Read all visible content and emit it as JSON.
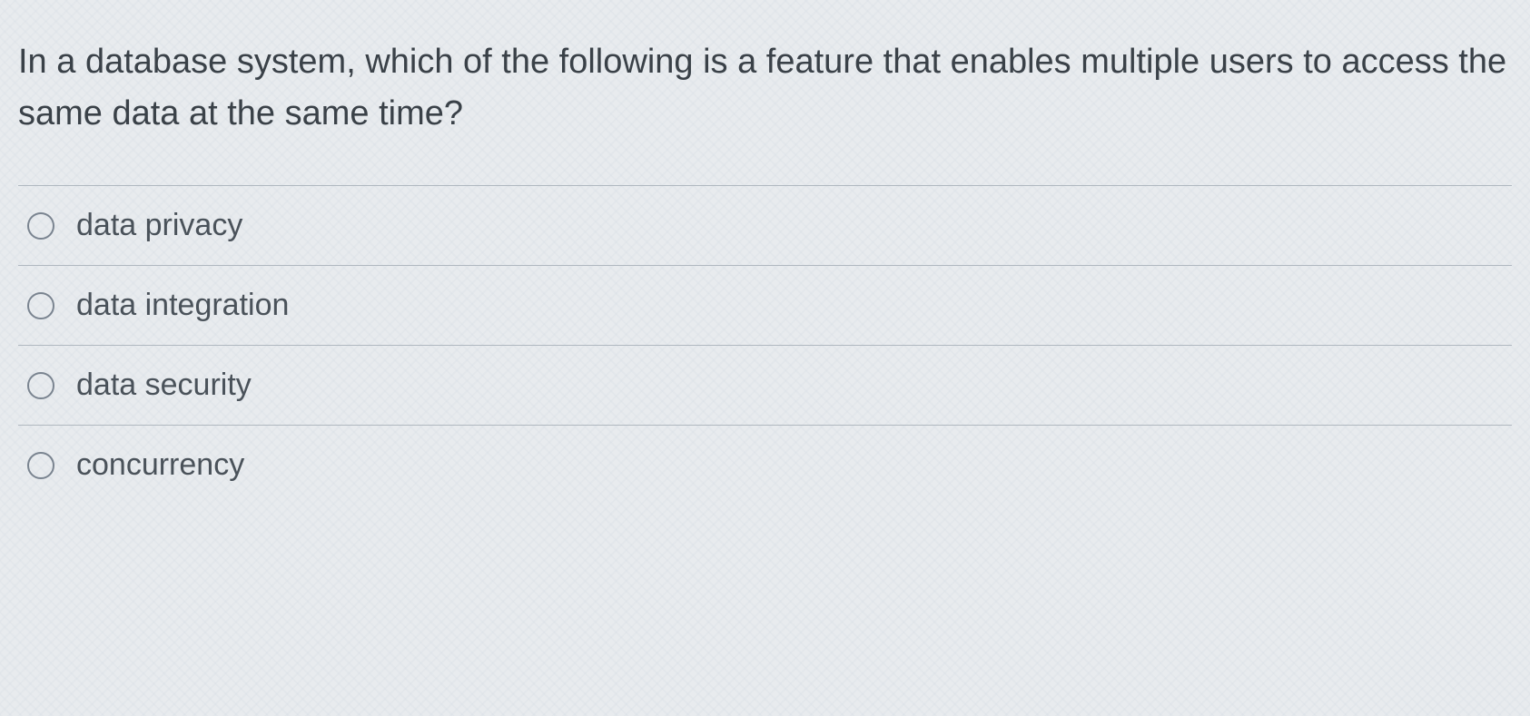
{
  "question": {
    "text": "In a database system, which of the following is a feature that enables multiple users to access the same data at the same time?"
  },
  "options": [
    {
      "label": "data privacy"
    },
    {
      "label": "data integration"
    },
    {
      "label": "data security"
    },
    {
      "label": "concurrency"
    }
  ]
}
